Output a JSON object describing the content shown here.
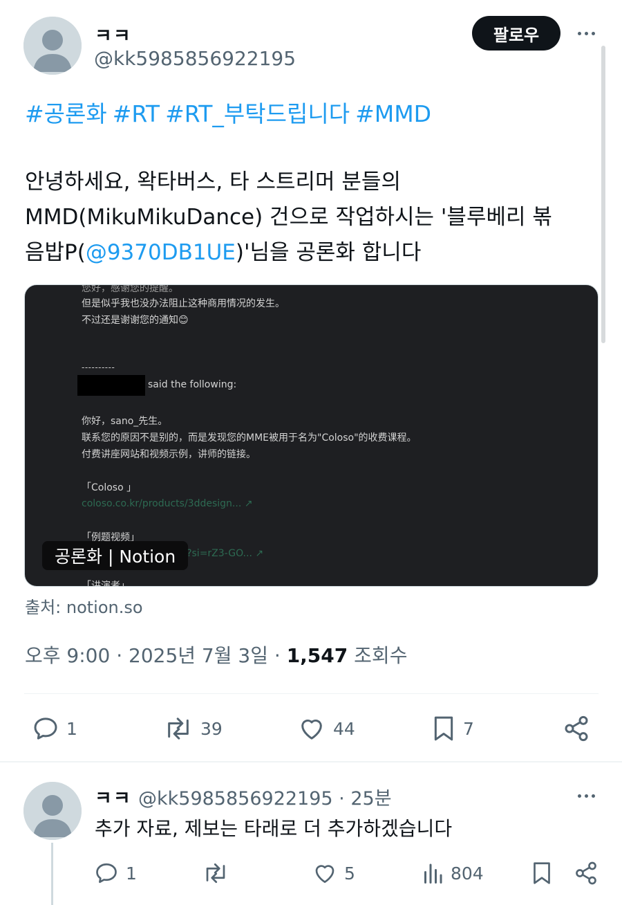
{
  "tweet": {
    "author_name": "ㅋㅋ",
    "author_handle": "@kk5985856922195",
    "follow_label": "팔로우",
    "hashtags": [
      "#공론화",
      "#RT",
      "#RT_부탁드립니다",
      "#MMD"
    ],
    "body_line1": "안녕하세요, 왁타버스, 타 스트리머 분들의",
    "body_line2": "MMD(MikuMikuDance) 건으로 작업하시는 '블루베리 볶",
    "body_line3_pre": "음밥P(",
    "body_mention": "@9370DB1UE",
    "body_line3_post": ")'님을 공론화 합니다",
    "card": {
      "label": "공론화 | Notion",
      "lines": [
        "您好，感谢您的提醒。",
        "但是似乎我也没办法阻止这种商用情况的发生。",
        "不过还是谢谢您的通知😊",
        "----------",
        "said the following:",
        "你好，sano_先生。",
        "联系您的原因不是别的，而是发现您的MME被用于名为\"Coloso\"的收费课程。",
        "付费讲座网站和视频示例，讲师的链接。",
        "「Coloso 」",
        "coloso.co.kr/products/3ddesign...",
        "「例题视频」",
        "M?si=rZ3-GO...",
        "「讲演者」"
      ]
    },
    "source": "출처: notion.so",
    "time": "오후 9:00",
    "date": "2025년 7월 3일",
    "views_count": "1,547",
    "views_label": "조회수",
    "actions": {
      "replies": "1",
      "retweets": "39",
      "likes": "44",
      "bookmarks": "7"
    },
    "colors": {
      "link": "#1d9bf0",
      "text": "#0f1419",
      "muted": "#536471"
    }
  },
  "reply": {
    "author_name": "ㅋㅋ",
    "author_handle": "@kk5985856922195",
    "time_ago": "25분",
    "text": "추가 자료, 제보는 타래로 더 추가하겠습니다",
    "actions": {
      "replies": "1",
      "likes": "5",
      "views": "804"
    }
  }
}
